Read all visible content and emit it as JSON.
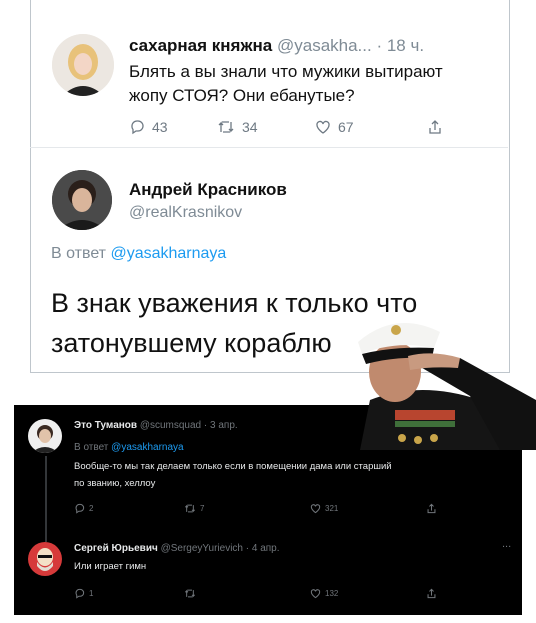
{
  "tweet1": {
    "display_name": "сахарная княжна",
    "handle_time": "@yasakha... · 18 ч.",
    "text_line1": "Блять а вы знали что мужики вытирают",
    "text_line2": "жопу СТОЯ? Они ебанутые?",
    "replies": "43",
    "retweets": "34",
    "likes": "67"
  },
  "tweet2": {
    "display_name": "Андрей Красников",
    "handle": "@realKrasnikov",
    "reply_prefix": "В ответ",
    "reply_handle": "@yasakharnaya",
    "text_line1": "В знак уважения к только что",
    "text_line2": "затонувшему кораблю"
  },
  "dark_tweet1": {
    "display_name": "Это Туманов",
    "handle_time": "@scumsquad · 3 апр.",
    "reply_prefix": "В ответ",
    "reply_handle": "@yasakharnaya",
    "text_line1": "Вообще-то мы так делаем только если в помещении дама или старший",
    "text_line2": "по званию, хеллоу",
    "replies": "2",
    "retweets": "7",
    "likes": "321"
  },
  "dark_tweet2": {
    "display_name": "Сергей Юрьевич",
    "handle_time": "@SergeyYurievich · 4 апр.",
    "text": "Или играет гимн",
    "replies": "1",
    "likes": "132",
    "more": "..."
  },
  "colors": {
    "link": "#1d9bf0",
    "muted_light": "#7f8b95",
    "dark_bg": "#000000",
    "avatar_red": "#d63a3a"
  }
}
